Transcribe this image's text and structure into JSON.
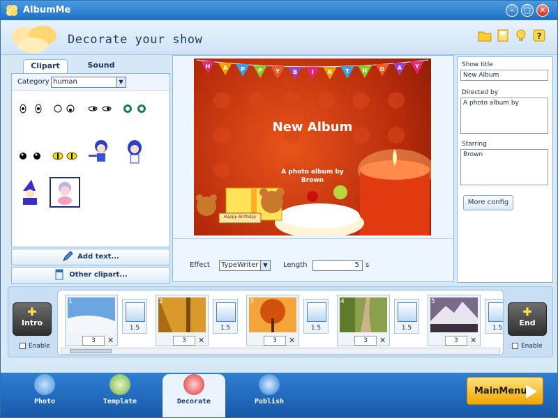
{
  "window": {
    "title": "AlbumMe"
  },
  "header": {
    "page_title": "Decorate your show"
  },
  "left_panel": {
    "tabs": [
      {
        "label": "Clipart"
      },
      {
        "label": "Sound"
      }
    ],
    "category_label": "Category",
    "category_value": "human",
    "add_text_label": "Add text...",
    "other_clipart_label": "Other clipart..."
  },
  "preview": {
    "banner_letters": [
      "H",
      "A",
      "P",
      "P",
      "Y",
      "B",
      "I",
      "R",
      "T",
      "H",
      "D",
      "A",
      "Y"
    ],
    "album_title": "New Album",
    "subtitle_line1": "A photo album by",
    "subtitle_line2": "Brown",
    "sign_text": "Happy Birthday"
  },
  "effect": {
    "effect_label": "Effect",
    "effect_value": "TypeWriter",
    "length_label": "Length",
    "length_value": "5",
    "length_unit": "s"
  },
  "right_panel": {
    "show_title_label": "Show title",
    "show_title_value": "New Album",
    "directed_by_label": "Directed by",
    "directed_by_value": "A photo album by",
    "starring_label": "Starring",
    "starring_value": "Brown",
    "more_config_label": "More config"
  },
  "timeline": {
    "intro_label": "Intro",
    "end_label": "End",
    "enable_label": "Enable",
    "photos": [
      {
        "num": "1",
        "duration": "3"
      },
      {
        "num": "2",
        "duration": "3"
      },
      {
        "num": "3",
        "duration": "3"
      },
      {
        "num": "4",
        "duration": "3"
      },
      {
        "num": "5",
        "duration": "3"
      }
    ],
    "transitions": [
      {
        "duration": "1.5"
      },
      {
        "duration": "1.5"
      },
      {
        "duration": "1.5"
      },
      {
        "duration": "1.5"
      },
      {
        "duration": "1.5"
      }
    ],
    "remove_symbol": "✕"
  },
  "bottom_nav": {
    "items": [
      {
        "label": "Photo"
      },
      {
        "label": "Template"
      },
      {
        "label": "Decorate"
      },
      {
        "label": "Publish"
      }
    ],
    "main_menu_label": "MainMenu"
  },
  "colors": {
    "accent": "#1e6fc4",
    "preview_bg": "#c8360f",
    "main_menu": "#f0a400"
  }
}
